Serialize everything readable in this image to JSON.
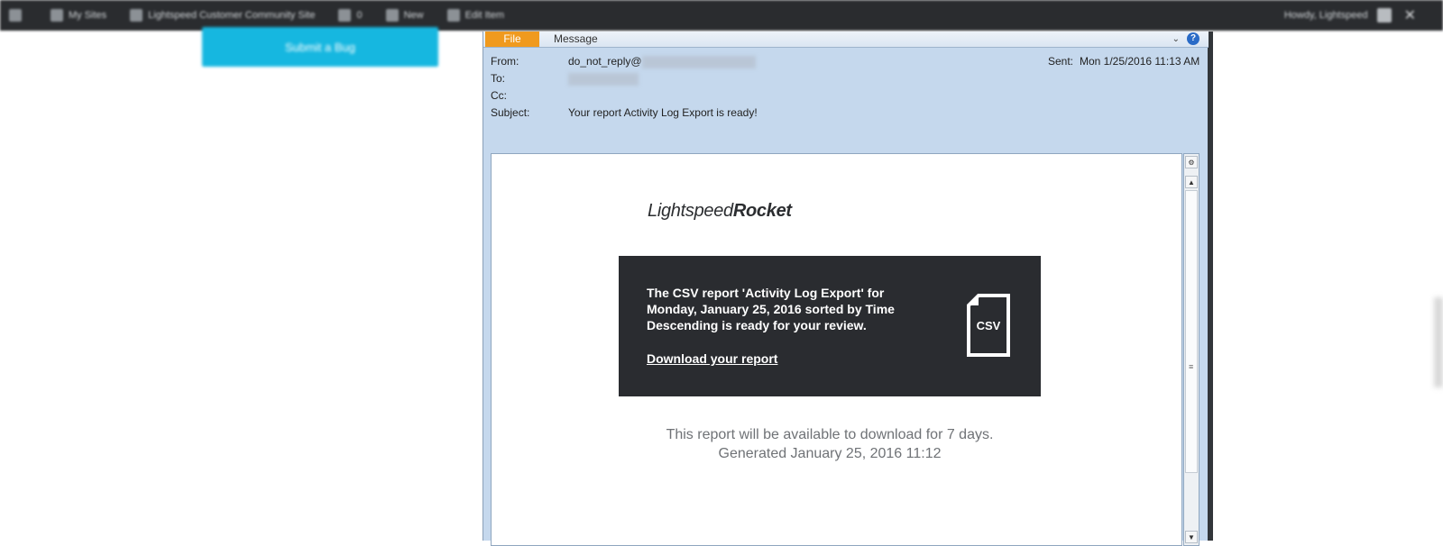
{
  "admin_bar": {
    "items": [
      "My Sites",
      "Lightspeed Customer Community Site",
      "0",
      "New",
      "Edit Item"
    ],
    "user": "Howdy, Lightspeed",
    "close": "✕"
  },
  "background": {
    "button_label": "Submit a Bug"
  },
  "window": {
    "ribbon": {
      "file_tab": "File",
      "message_tab": "Message",
      "chevron": "⌄",
      "help": "?"
    },
    "header": {
      "from_label": "From:",
      "from_value": "do_not_reply@",
      "to_label": "To:",
      "cc_label": "Cc:",
      "subject_label": "Subject:",
      "subject_value": "Your report Activity Log Export is ready!",
      "sent_label": "Sent:",
      "sent_value": "Mon 1/25/2016 11:13 AM"
    },
    "email": {
      "logo_light": "Lightspeed",
      "logo_bold": "Rocket",
      "report_message": "The CSV report 'Activity Log Export' for Monday, January 25, 2016 sorted by Time Descending is ready for your review.",
      "download_link": "Download your report",
      "csv_icon_label": "CSV",
      "availability_line": "This report will be available to download for 7 days.",
      "generated_line": "Generated January 25, 2016 11:12"
    },
    "scrollbar": {
      "up": "▲",
      "down": "▼",
      "grip": "≡"
    }
  }
}
